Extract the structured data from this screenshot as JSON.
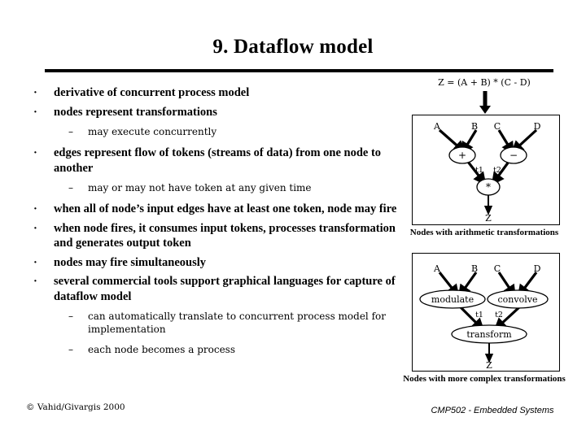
{
  "slide": {
    "title": "9. Dataflow model",
    "footer_left": "© Vahid/Givargis 2000",
    "footer_right": "CMP502 - Embedded Systems"
  },
  "bullets": [
    {
      "level": 1,
      "marker": "·",
      "text": "derivative of concurrent process model"
    },
    {
      "level": 1,
      "marker": "·",
      "text": "nodes represent transformations"
    },
    {
      "level": 2,
      "marker": "–",
      "text": "may execute concurrently"
    },
    {
      "level": 1,
      "marker": "·",
      "text": "edges represent flow of tokens (streams of data) from one node to another"
    },
    {
      "level": 2,
      "marker": "–",
      "text": "may or may not have token at any given time"
    },
    {
      "level": 1,
      "marker": "·",
      "text": "when all of node’s input edges have at least one token, node may fire"
    },
    {
      "level": 1,
      "marker": "·",
      "text": "when node fires, it consumes input tokens, processes transformation and generates output token"
    },
    {
      "level": 1,
      "marker": "·",
      "text": "nodes may fire simultaneously"
    },
    {
      "level": 1,
      "marker": "·",
      "text": "several commercial tools support graphical languages for capture of dataflow model"
    },
    {
      "level": 2,
      "marker": "–",
      "text": "can automatically translate to concurrent process model for implementation"
    },
    {
      "level": 2,
      "marker": "–",
      "text": "each node becomes a process"
    }
  ],
  "diagram": {
    "equation": "Z = (A + B) * (C - D)",
    "graph1": {
      "inputs": [
        "A",
        "B",
        "C",
        "D"
      ],
      "nodes": [
        "+",
        "−",
        "*"
      ],
      "intermediate": [
        "t1",
        "t2"
      ],
      "output": "Z",
      "caption": "Nodes with arithmetic transformations"
    },
    "graph2": {
      "inputs": [
        "A",
        "B",
        "C",
        "D"
      ],
      "nodes": [
        "modulate",
        "convolve",
        "transform"
      ],
      "intermediate": [
        "t1",
        "t2"
      ],
      "output": "Z",
      "caption": "Nodes with more complex transformations"
    }
  }
}
